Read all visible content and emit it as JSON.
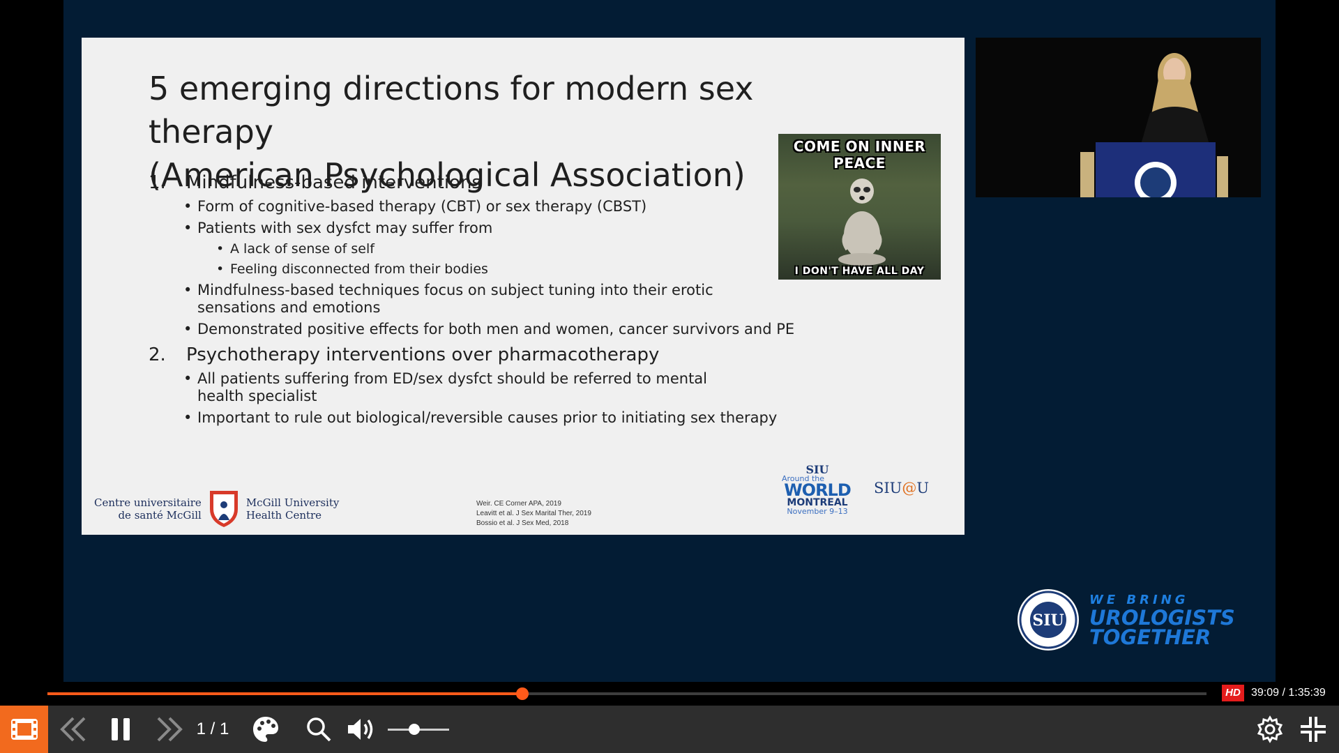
{
  "slide": {
    "title_line1": "5 emerging directions for modern sex therapy",
    "title_line2": "(American Psychological Association)",
    "sections": [
      {
        "number": "1.",
        "heading": "Mindfulness-based interventions",
        "bullets": [
          {
            "text": "Form of cognitive-based therapy (CBT) or sex therapy (CBST)",
            "sub": []
          },
          {
            "text": "Patients with sex dysfct may suffer from",
            "sub": [
              "A lack of sense of self",
              "Feeling disconnected from their bodies"
            ]
          },
          {
            "text": "Mindfulness-based techniques focus on subject tuning into their erotic sensations and emotions",
            "sub": []
          },
          {
            "text": "Demonstrated positive effects for both men and women, cancer survivors and PE",
            "sub": []
          }
        ]
      },
      {
        "number": "2.",
        "heading": "Psychotherapy interventions over pharmacotherapy",
        "bullets": [
          {
            "text": "All patients suffering from ED/sex dysfct should be referred to mental health specialist",
            "sub": []
          },
          {
            "text": "Important to rule out biological/reversible causes prior to initiating sex therapy",
            "sub": []
          }
        ]
      }
    ],
    "meme": {
      "top_text": "COME ON INNER PEACE",
      "bottom_text": "I DON'T HAVE ALL DAY"
    },
    "mcgill": {
      "fr_line1": "Centre universitaire",
      "fr_line2": "de santé McGill",
      "en_line1": "McGill University",
      "en_line2": "Health Centre"
    },
    "references": [
      "Weir. CE Corner APA, 2019",
      "Leavitt et al. J Sex Marital Ther, 2019",
      "Bossio et al. J Sex Med, 2018"
    ],
    "siu_world": {
      "line1": "SIU",
      "line2": "WORLD",
      "around": "Around the",
      "line3": "MONTREAL",
      "dates": "November 9–13"
    },
    "siu_at_u": {
      "pre": "SIU",
      "at": "@",
      "post": "U"
    }
  },
  "brand": {
    "line1": "WE BRING",
    "line2": "UROLOGISTS",
    "line3": "TOGETHER",
    "seal_text": "SIU"
  },
  "player": {
    "progress_fraction": 0.4098,
    "hd_label": "HD",
    "time_text": "39:09 / 1:35:39",
    "pager_text": "1 / 1",
    "volume_fraction": 0.43,
    "icons": [
      "film-strip-icon",
      "skip-back-icon",
      "pause-icon",
      "skip-forward-icon",
      "palette-icon",
      "search-icon",
      "volume-icon",
      "settings-gear-icon",
      "exit-fullscreen-icon"
    ]
  },
  "colors": {
    "accent": "#ff5a1a",
    "stage_bg": "#031c34",
    "control_bg": "#2e2e2e",
    "hd_red": "#e51c1c",
    "brand_blue": "#1e7fe0"
  }
}
